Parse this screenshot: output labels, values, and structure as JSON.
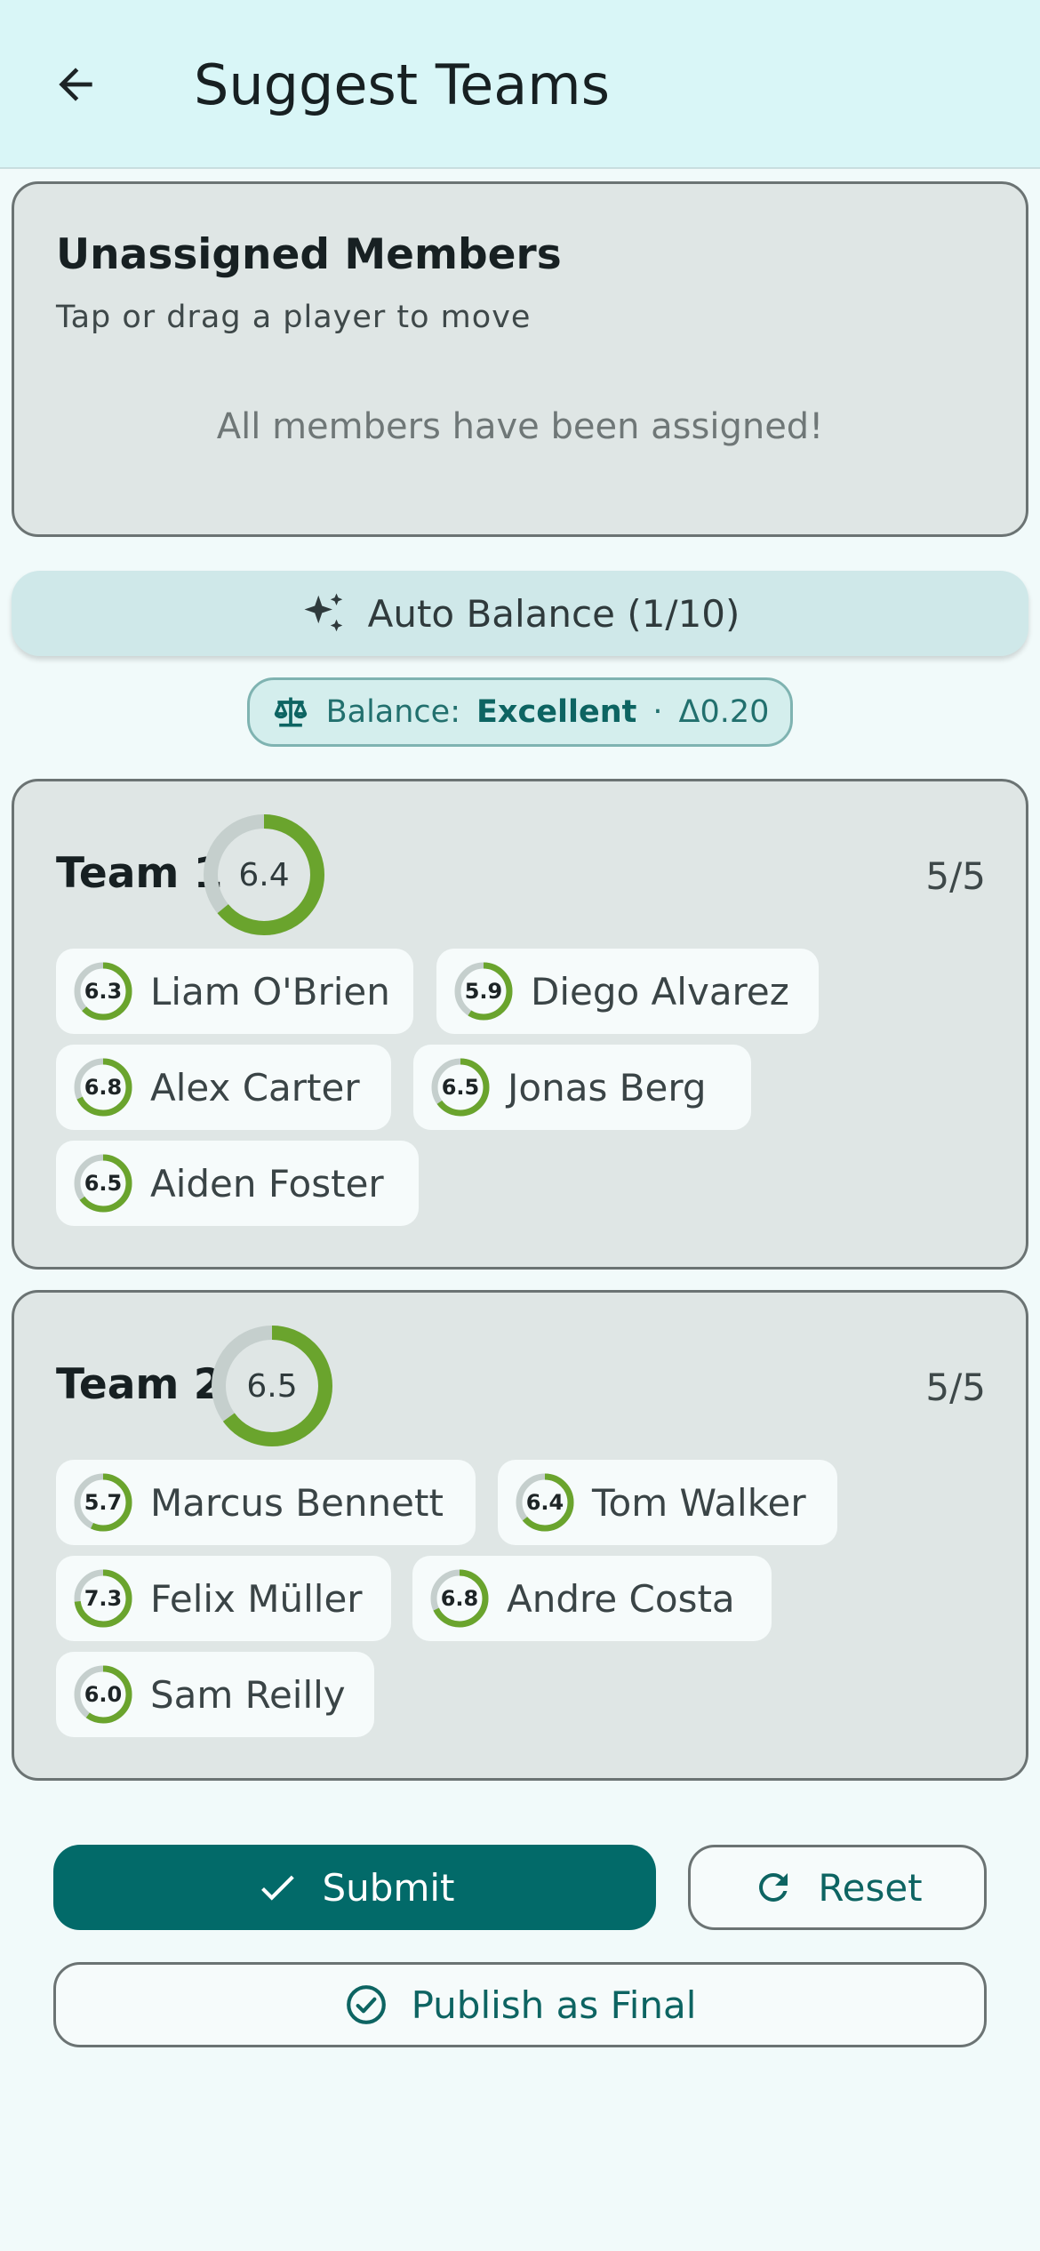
{
  "appbar": {
    "title": "Suggest Teams",
    "back_icon": "arrow-left-icon"
  },
  "unassigned": {
    "title": "Unassigned Members",
    "subtitle": "Tap or drag a player to move",
    "empty_message": "All members have been assigned!"
  },
  "auto_balance": {
    "label": "Auto Balance (1/10)",
    "icon": "sparkles-icon"
  },
  "balance": {
    "prefix": "Balance:",
    "rating": "Excellent",
    "separator": "·",
    "delta": "Δ0.20",
    "icon": "scale-icon"
  },
  "colors": {
    "rating_ring": "#6aa42d",
    "ring_track": "#c5cfcd",
    "primary": "#026a69"
  },
  "teams": [
    {
      "name": "Team 1",
      "rating": "6.4",
      "rating_fraction": 0.64,
      "count": "5/5",
      "players": [
        {
          "name": "Liam O'Brien",
          "rating": "6.3"
        },
        {
          "name": "Diego Alvarez",
          "rating": "5.9"
        },
        {
          "name": "Alex Carter",
          "rating": "6.8"
        },
        {
          "name": "Jonas Berg",
          "rating": "6.5"
        },
        {
          "name": "Aiden Foster",
          "rating": "6.5"
        }
      ]
    },
    {
      "name": "Team 2",
      "rating": "6.5",
      "rating_fraction": 0.65,
      "count": "5/5",
      "players": [
        {
          "name": "Marcus Bennett",
          "rating": "5.7"
        },
        {
          "name": "Tom Walker",
          "rating": "6.4"
        },
        {
          "name": "Felix Müller",
          "rating": "7.3"
        },
        {
          "name": "Andre Costa",
          "rating": "6.8"
        },
        {
          "name": "Sam Reilly",
          "rating": "6.0"
        }
      ]
    }
  ],
  "actions": {
    "submit": "Submit",
    "reset": "Reset",
    "publish": "Publish as Final"
  }
}
